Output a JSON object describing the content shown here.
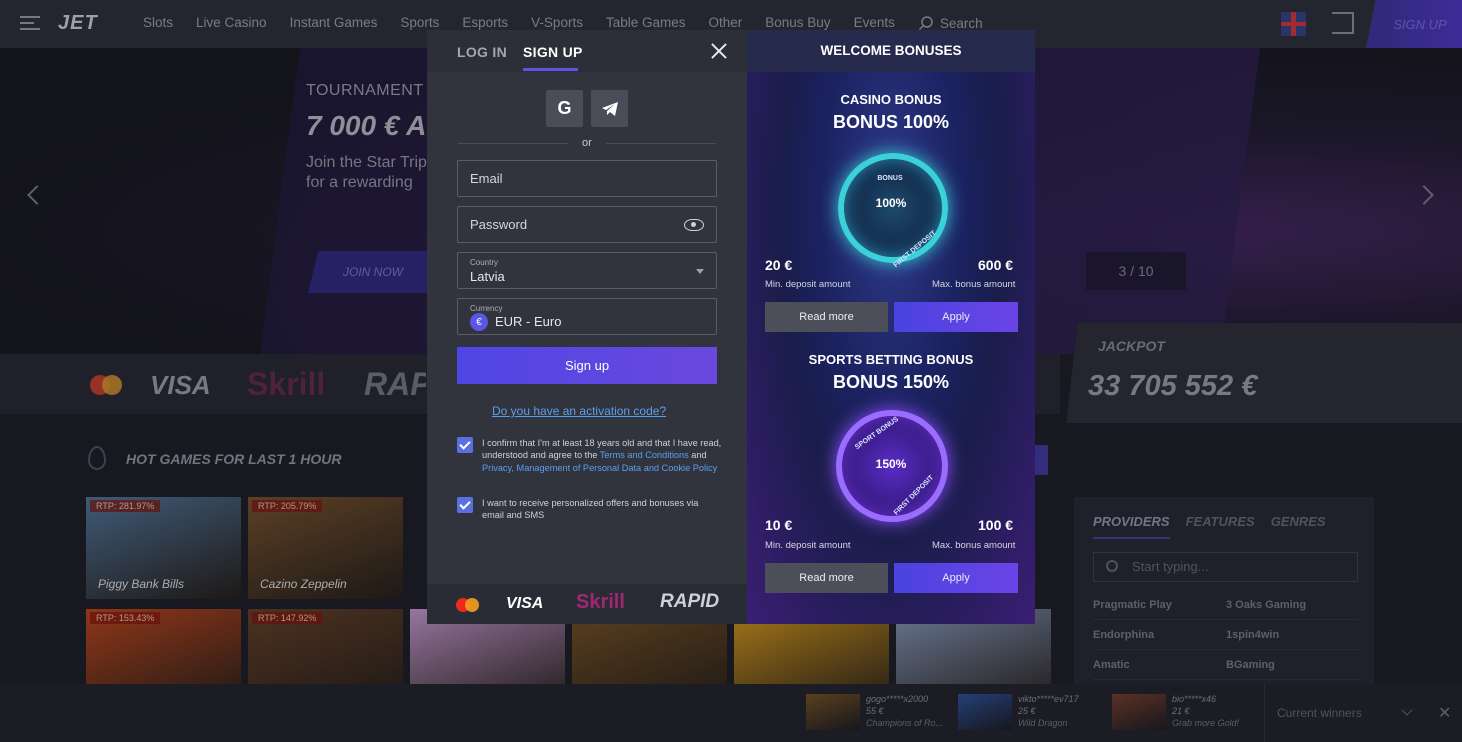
{
  "header": {
    "logo": "JET",
    "nav": [
      "Slots",
      "Live Casino",
      "Instant Games",
      "Sports",
      "Esports",
      "V-Sports",
      "Table Games",
      "Other",
      "Bonus Buy",
      "Events"
    ],
    "search_label": "Search",
    "signup_label": "SIGN UP"
  },
  "hero": {
    "label": "TOURNAMENT",
    "amount": "7 000 € A",
    "desc": "Join the Star Trip for a rewarding",
    "cta": "JOIN NOW",
    "counter": "3 / 10"
  },
  "jackpot": {
    "label": "JACKPOT",
    "value": "33 705 552 €"
  },
  "payments_bg": {
    "visa": "VISA",
    "skrill": "Skrill",
    "rapid": "RAPID"
  },
  "hot_games": {
    "title": "HOT GAMES FOR LAST 1 HOUR",
    "tiles": [
      {
        "rtp": "RTP: 281.97%",
        "name": "Piggy Bank Bills",
        "color": "#4a6a8a"
      },
      {
        "rtp": "RTP: 205.79%",
        "name": "Cazino Zeppelin",
        "color": "#6a4a2a"
      },
      {
        "rtp": "RTP: 153.43%",
        "name": "",
        "color": "#a8401a"
      },
      {
        "rtp": "RTP: 147.92%",
        "name": "",
        "color": "#5a3a24"
      },
      {
        "rtp": "",
        "name": "",
        "color": "#b08ab8"
      },
      {
        "rtp": "",
        "name": "",
        "color": "#6a4a22"
      },
      {
        "rtp": "",
        "name": "",
        "color": "#c08a1a"
      },
      {
        "rtp": "",
        "name": "",
        "color": "#7a8aa8"
      }
    ]
  },
  "providers": {
    "tabs": [
      "PROVIDERS",
      "FEATURES",
      "GENRES"
    ],
    "search_placeholder": "Start typing...",
    "rows": [
      [
        "Pragmatic Play",
        "3 Oaks Gaming"
      ],
      [
        "Endorphina",
        "1spin4win"
      ],
      [
        "Amatic",
        "BGaming"
      ]
    ]
  },
  "winners": {
    "items": [
      {
        "user": "gogo*****x2000",
        "amount": "55 €",
        "game": "Champions of Ro...",
        "color": "#6a4a20"
      },
      {
        "user": "vikto*****ev717",
        "amount": "25 €",
        "game": "Wild Dragon",
        "color": "#2a4a8a"
      },
      {
        "user": "bio*****x46",
        "amount": "21 €",
        "game": "Grab more Gold!",
        "color": "#6a3a2a"
      }
    ],
    "label": "Current winners"
  },
  "modal": {
    "tab_login": "LOG IN",
    "tab_signup": "SIGN UP",
    "or": "or",
    "email_placeholder": "Email",
    "password_placeholder": "Password",
    "country_label": "Country",
    "country_value": "Latvia",
    "currency_label": "Currency",
    "currency_value": "EUR - Euro",
    "signup_button": "Sign up",
    "activation_link": "Do you have an activation code?",
    "consent_text_1": "I confirm that I'm at least 18 years old and that I have read, understood and agree to the ",
    "consent_link_1": "Terms and Conditions",
    "consent_and": " and ",
    "consent_link_2": "Privacy, Management of Personal Data and Cookie Policy",
    "consent_offers": "I want to receive personalized offers and bonuses via email and SMS",
    "footer": {
      "visa": "VISA",
      "skrill": "Skrill",
      "rapid": "RAPID"
    }
  },
  "bonuses": {
    "title": "WELCOME BONUSES",
    "items": [
      {
        "title": "CASINO BONUS",
        "big": "BONUS 100%",
        "ring_top": "BONUS",
        "ring_center": "100%",
        "ring_bottom": "FIRST DEPOSIT",
        "min": "20 €",
        "min_label": "Min. deposit amount",
        "max": "600 €",
        "max_label": "Max. bonus amount",
        "read_more": "Read more",
        "apply": "Apply"
      },
      {
        "title": "SPORTS BETTING BONUS",
        "big": "BONUS 150%",
        "ring_top": "SPORT BONUS",
        "ring_center": "150%",
        "ring_bottom": "FIRST DEPOSIT",
        "min": "10 €",
        "min_label": "Min. deposit amount",
        "max": "100 €",
        "max_label": "Max. bonus amount",
        "read_more": "Read more",
        "apply": "Apply"
      }
    ]
  }
}
